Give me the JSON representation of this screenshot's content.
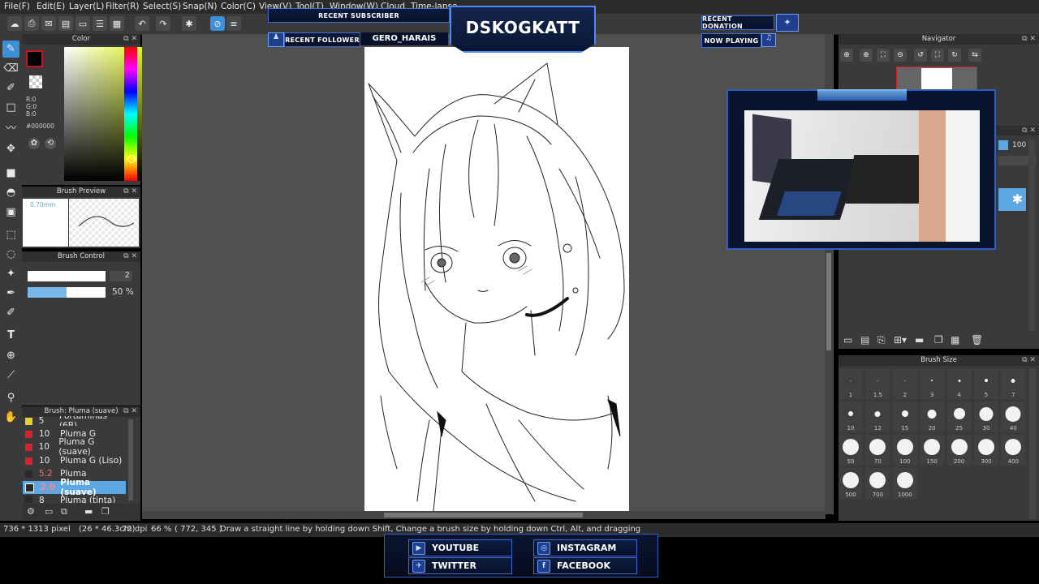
{
  "menu": [
    "File(F)",
    "Edit(E)",
    "Layer(L)",
    "Filter(R)",
    "Select(S)",
    "Snap(N)",
    "Color(C)",
    "View(V)",
    "Tool(T)",
    "Window(W)",
    "Cloud",
    "Time-lapse"
  ],
  "stream": {
    "channel": "DSKOGKATT",
    "recent_subscriber_label": "RECENT SUBSCRIBER",
    "recent_follower_label": "RECENT FOLLOWER",
    "recent_follower_name": "GERO_HARAIS",
    "recent_donation_label": "RECENT DONATION",
    "now_playing_label": "NOW PLAYING",
    "socials": [
      "YOUTUBE",
      "INSTAGRAM",
      "TWITTER",
      "FACEBOOK"
    ]
  },
  "color_panel": {
    "title": "Color",
    "r": "R:0",
    "g": "G:0",
    "b": "B:0",
    "hex": "#000000"
  },
  "brush_preview": {
    "title": "Brush Preview",
    "size": "0.70mm"
  },
  "brush_control": {
    "title": "Brush Control",
    "size_value": "2",
    "opacity_value": "50 %",
    "opacity_fraction": 0.5
  },
  "brush_list": {
    "title": "Brush: Pluma (suave)",
    "items": [
      {
        "num": "5",
        "name": "Portaminas (6B)",
        "color": "#e6d02c"
      },
      {
        "num": "10",
        "name": "Pluma G",
        "color": "#d8242c"
      },
      {
        "num": "10",
        "name": "Pluma G (suave)",
        "color": "#d8242c"
      },
      {
        "num": "10",
        "name": "Pluma G (Liso)",
        "color": "#d8242c"
      },
      {
        "num": "5.2",
        "name": "Pluma",
        "color": "#2a2a2a"
      },
      {
        "num": "2.0",
        "name": "Pluma (suave)",
        "color": "#2a2a2a",
        "selected": true
      },
      {
        "num": "8",
        "name": "Pluma (tinta)",
        "color": "#2a2a2a"
      }
    ]
  },
  "navigator": {
    "title": "Navigator",
    "opacity": "100 %"
  },
  "brush_size": {
    "title": "Brush Size",
    "sizes": [
      "1",
      "1.5",
      "2",
      "3",
      "4",
      "5",
      "7",
      "10",
      "12",
      "15",
      "20",
      "25",
      "30",
      "40",
      "50",
      "70",
      "100",
      "150",
      "200",
      "300",
      "400",
      "500",
      "700",
      "1000"
    ]
  },
  "status": {
    "dimensions": "736 * 1313 pixel",
    "cm": "(26 * 46.3cm)",
    "dpi": "72 dpi",
    "zoom": "66 %",
    "coords": "( 772, 345 )",
    "hint": "Draw a straight line by holding down Shift, Change a brush size by holding down Ctrl, Alt, and dragging"
  },
  "colors": {
    "accent": "#3c8fd8",
    "panel": "#3a3a3a",
    "canvas_bg": "#505050",
    "overlay_blue": "#3c6fd1"
  }
}
